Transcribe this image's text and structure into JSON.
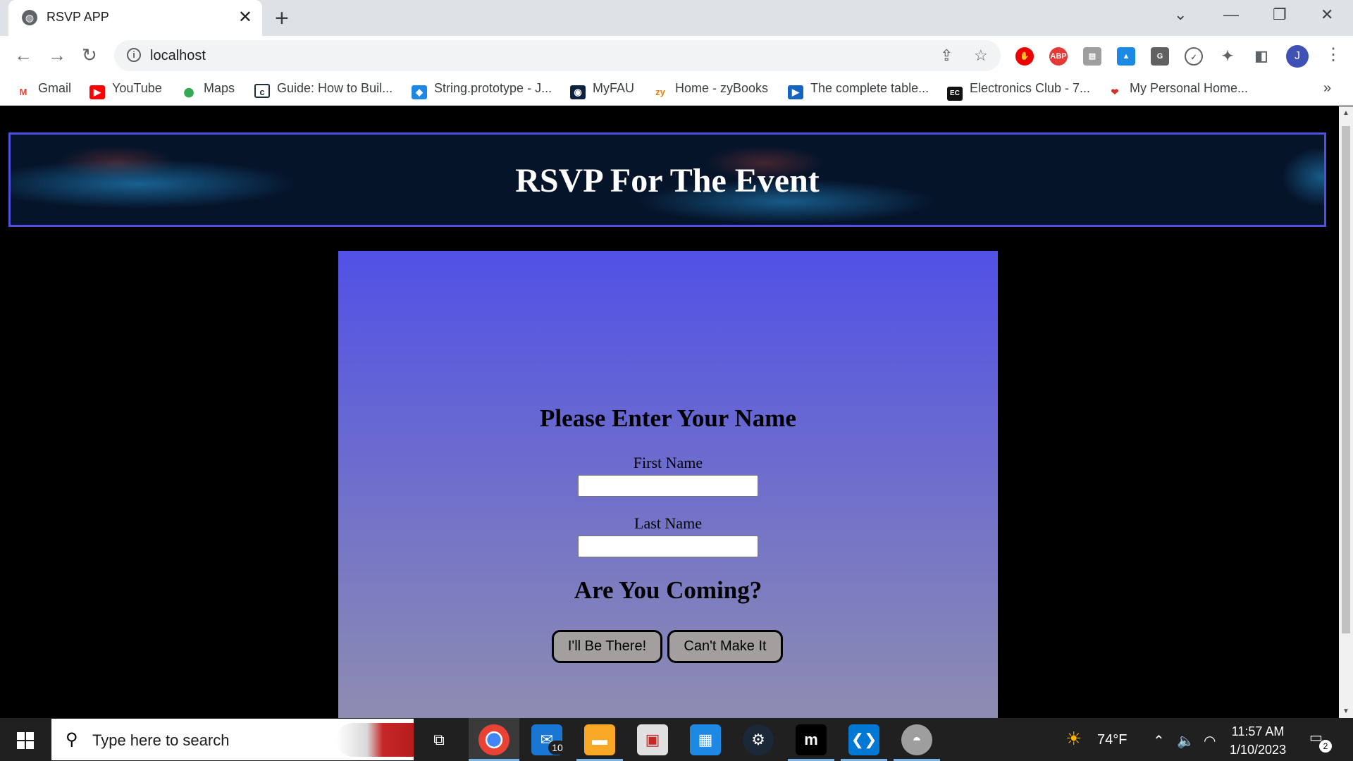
{
  "browser": {
    "tab_title": "RSVP APP",
    "new_tab_symbol": "+",
    "close_symbol": "✕",
    "url": "localhost",
    "profile_initial": "J",
    "bookmarks": [
      {
        "label": "Gmail",
        "icon": "gmail-icon",
        "color": "#ea4335",
        "glyph": "M"
      },
      {
        "label": "YouTube",
        "icon": "youtube-icon",
        "color": "#ff0000",
        "glyph": "▶"
      },
      {
        "label": "Maps",
        "icon": "maps-icon",
        "color": "#34a853",
        "glyph": "⬤"
      },
      {
        "label": "Guide: How to Buil...",
        "icon": "c-icon",
        "color": "#1d2b3a",
        "glyph": "c"
      },
      {
        "label": "String.prototype - J...",
        "icon": "mdn-icon",
        "color": "#1e88e5",
        "glyph": "◆"
      },
      {
        "label": "MyFAU",
        "icon": "owl-icon",
        "color": "#0d2240",
        "glyph": "◉"
      },
      {
        "label": "Home - zyBooks",
        "icon": "zybooks-icon",
        "color": "#f57c00",
        "glyph": "zy"
      },
      {
        "label": "The complete table...",
        "icon": "bookmark-icon",
        "color": "#1565c0",
        "glyph": "▶"
      },
      {
        "label": "Electronics Club - 7...",
        "icon": "ec-icon",
        "color": "#111111",
        "glyph": "EC"
      },
      {
        "label": "My Personal Home...",
        "icon": "lips-icon",
        "color": "#d32f2f",
        "glyph": "❤"
      }
    ],
    "more_symbol": "»"
  },
  "page": {
    "banner_title": "RSVP For The Event",
    "form_heading": "Please Enter Your Name",
    "first_name_label": "First Name",
    "first_name_value": "",
    "last_name_label": "Last Name",
    "last_name_value": "",
    "question_heading": "Are You Coming?",
    "yes_button": "I'll Be There!",
    "no_button": "Can't Make It"
  },
  "taskbar": {
    "search_placeholder": "Type here to search",
    "mail_badge": "10",
    "weather": "74°F",
    "time": "11:57 AM",
    "date": "1/10/2023",
    "notification_count": "2"
  }
}
